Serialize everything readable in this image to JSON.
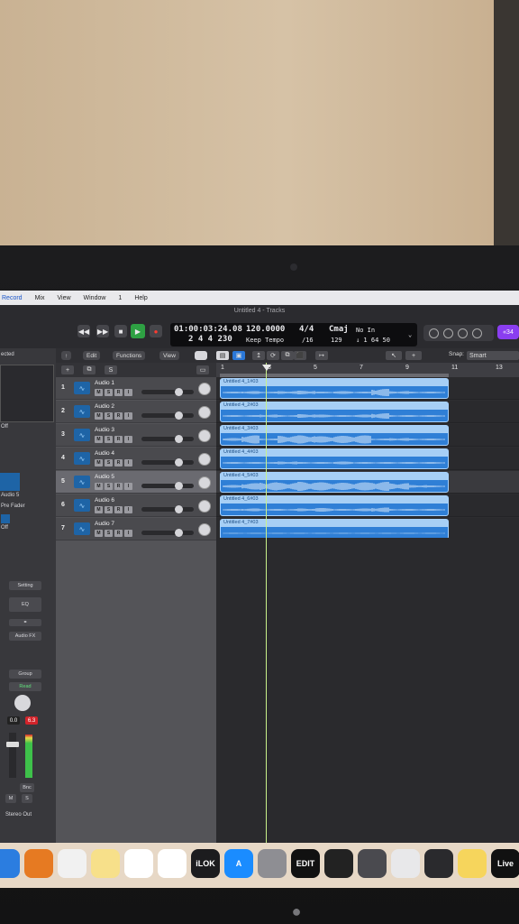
{
  "menubar": [
    "Record",
    "Mix",
    "View",
    "Window",
    "1",
    "Help"
  ],
  "window": {
    "title": "Untitled 4 - Tracks"
  },
  "transport": {
    "time": "01:00:03:24.08",
    "bars": "2  4  4  230",
    "tempo": "120.0000",
    "tempo_mode": "Keep Tempo",
    "signature": "4/4",
    "division": "/16",
    "key": "Cmaj",
    "key_value": "129",
    "input": "No In",
    "output": "↓ 1  64  50",
    "badge": "«34"
  },
  "inspector": {
    "region_label": "ected",
    "off_label": "Off",
    "channel_name": "Audio 5",
    "pre_fader": "Pre Fader",
    "off_label2": "Off",
    "setting": "Setting",
    "eq": "EQ",
    "audio_fx": "Audio FX",
    "group": "Group",
    "read": "Read",
    "vol_left": "0.0",
    "vol_right": "6.3",
    "bounce": "Bnc",
    "m": "M",
    "s": "S",
    "stereo_out": "Stereo Out"
  },
  "toolbar": {
    "edit": "Edit",
    "functions": "Functions",
    "view": "View",
    "snap_label": "Snap:",
    "snap_value": "Smart"
  },
  "ruler": [
    "1",
    "3",
    "5",
    "7",
    "9",
    "11",
    "13"
  ],
  "tracks": [
    {
      "num": "1",
      "name": "Audio 1",
      "region": "Untitled 4_1#03",
      "fader": 0.7,
      "selected": false
    },
    {
      "num": "2",
      "name": "Audio 2",
      "region": "Untitled 4_2#03",
      "fader": 0.7,
      "selected": false
    },
    {
      "num": "3",
      "name": "Audio 3",
      "region": "Untitled 4_3#03",
      "fader": 0.7,
      "selected": false
    },
    {
      "num": "4",
      "name": "Audio 4",
      "region": "Untitled 4_4#03",
      "fader": 0.7,
      "selected": false
    },
    {
      "num": "5",
      "name": "Audio 5",
      "region": "Untitled 4_5#03",
      "fader": 0.7,
      "selected": true
    },
    {
      "num": "6",
      "name": "Audio 6",
      "region": "Untitled 4_6#03",
      "fader": 0.7,
      "selected": false
    },
    {
      "num": "7",
      "name": "Audio 7",
      "region": "Untitled 4_7#03",
      "fader": 0.7,
      "selected": false
    }
  ],
  "track_buttons": [
    "M",
    "S",
    "R",
    "I"
  ],
  "dock": [
    {
      "name": "finder",
      "label": "",
      "color": "#2b7de0"
    },
    {
      "name": "garageband",
      "label": "",
      "color": "#e67a22"
    },
    {
      "name": "chrome",
      "label": "",
      "color": "#f1f1f1"
    },
    {
      "name": "notes",
      "label": "",
      "color": "#f7e08a"
    },
    {
      "name": "freeform",
      "label": "",
      "color": "#ffffff"
    },
    {
      "name": "reminders",
      "label": "",
      "color": "#ffffff"
    },
    {
      "name": "ilok",
      "label": "iLOK",
      "color": "#1c1c1e"
    },
    {
      "name": "app-store",
      "label": "A",
      "color": "#1a8cff"
    },
    {
      "name": "system-settings",
      "label": "",
      "color": "#8e8e93"
    },
    {
      "name": "xedit",
      "label": "EDIT",
      "color": "#111111"
    },
    {
      "name": "piano",
      "label": "",
      "color": "#222222"
    },
    {
      "name": "logic",
      "label": "",
      "color": "#4a4a4f"
    },
    {
      "name": "ua-console",
      "label": "",
      "color": "#e8e8ea"
    },
    {
      "name": "ua-connect",
      "label": "",
      "color": "#2a2a2d"
    },
    {
      "name": "stickies",
      "label": "",
      "color": "#f6d55c"
    },
    {
      "name": "ableton-live",
      "label": "Live",
      "color": "#111111"
    }
  ]
}
